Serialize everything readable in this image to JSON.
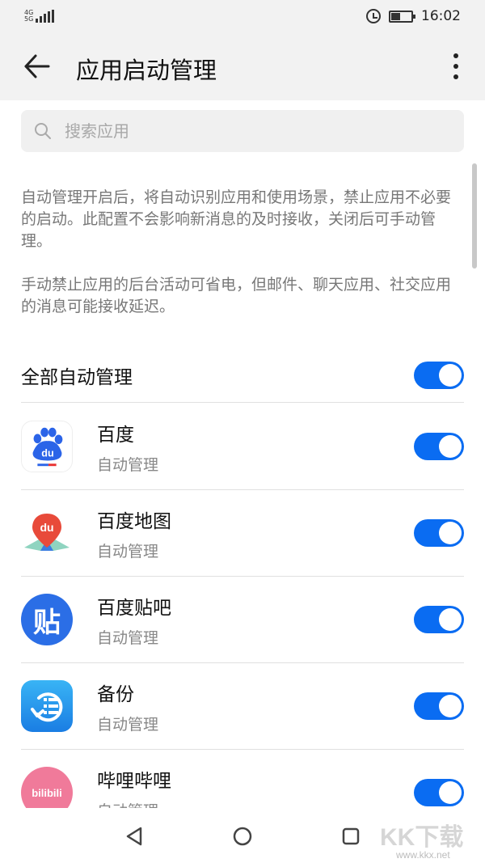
{
  "status_bar": {
    "network": "4G",
    "network_sub": "5G",
    "time": "16:02",
    "battery_level": 0.45
  },
  "app_bar": {
    "title": "应用启动管理"
  },
  "search": {
    "placeholder": "搜索应用"
  },
  "descriptions": [
    "自动管理开启后，将自动识别应用和使用场景，禁止应用不必要的启动。此配置不会影响新消息的及时接收，关闭后可手动管理。",
    "手动禁止应用的后台活动可省电，但邮件、聊天应用、社交应用的消息可能接收延迟。"
  ],
  "master_toggle": {
    "label": "全部自动管理",
    "on": true
  },
  "apps": [
    {
      "name": "百度",
      "status": "自动管理",
      "icon": "baidu-icon",
      "on": true
    },
    {
      "name": "百度地图",
      "status": "自动管理",
      "icon": "baidu-map-icon",
      "on": true
    },
    {
      "name": "百度贴吧",
      "status": "自动管理",
      "icon": "tieba-icon",
      "icon_text": "贴",
      "on": true
    },
    {
      "name": "备份",
      "status": "自动管理",
      "icon": "backup-icon",
      "on": true
    },
    {
      "name": "哔哩哔哩",
      "status": "自动管理",
      "icon": "bilibili-icon",
      "icon_text": "bilibili",
      "on": true
    }
  ],
  "watermark": {
    "text": "KK下载",
    "url": "www.kkx.net"
  },
  "colors": {
    "accent": "#0a6cf2",
    "bar_bg": "#f2f2f2"
  }
}
